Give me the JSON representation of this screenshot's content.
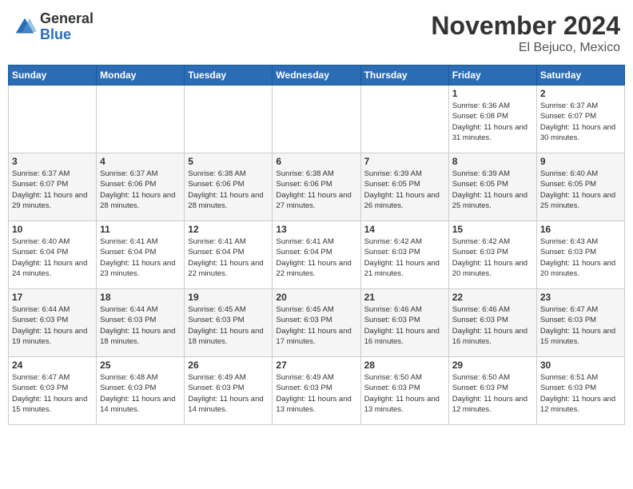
{
  "header": {
    "logo_general": "General",
    "logo_blue": "Blue",
    "month_title": "November 2024",
    "location": "El Bejuco, Mexico"
  },
  "calendar": {
    "days_of_week": [
      "Sunday",
      "Monday",
      "Tuesday",
      "Wednesday",
      "Thursday",
      "Friday",
      "Saturday"
    ],
    "weeks": [
      [
        {
          "day": "",
          "info": ""
        },
        {
          "day": "",
          "info": ""
        },
        {
          "day": "",
          "info": ""
        },
        {
          "day": "",
          "info": ""
        },
        {
          "day": "",
          "info": ""
        },
        {
          "day": "1",
          "info": "Sunrise: 6:36 AM\nSunset: 6:08 PM\nDaylight: 11 hours and 31 minutes."
        },
        {
          "day": "2",
          "info": "Sunrise: 6:37 AM\nSunset: 6:07 PM\nDaylight: 11 hours and 30 minutes."
        }
      ],
      [
        {
          "day": "3",
          "info": "Sunrise: 6:37 AM\nSunset: 6:07 PM\nDaylight: 11 hours and 29 minutes."
        },
        {
          "day": "4",
          "info": "Sunrise: 6:37 AM\nSunset: 6:06 PM\nDaylight: 11 hours and 28 minutes."
        },
        {
          "day": "5",
          "info": "Sunrise: 6:38 AM\nSunset: 6:06 PM\nDaylight: 11 hours and 28 minutes."
        },
        {
          "day": "6",
          "info": "Sunrise: 6:38 AM\nSunset: 6:06 PM\nDaylight: 11 hours and 27 minutes."
        },
        {
          "day": "7",
          "info": "Sunrise: 6:39 AM\nSunset: 6:05 PM\nDaylight: 11 hours and 26 minutes."
        },
        {
          "day": "8",
          "info": "Sunrise: 6:39 AM\nSunset: 6:05 PM\nDaylight: 11 hours and 25 minutes."
        },
        {
          "day": "9",
          "info": "Sunrise: 6:40 AM\nSunset: 6:05 PM\nDaylight: 11 hours and 25 minutes."
        }
      ],
      [
        {
          "day": "10",
          "info": "Sunrise: 6:40 AM\nSunset: 6:04 PM\nDaylight: 11 hours and 24 minutes."
        },
        {
          "day": "11",
          "info": "Sunrise: 6:41 AM\nSunset: 6:04 PM\nDaylight: 11 hours and 23 minutes."
        },
        {
          "day": "12",
          "info": "Sunrise: 6:41 AM\nSunset: 6:04 PM\nDaylight: 11 hours and 22 minutes."
        },
        {
          "day": "13",
          "info": "Sunrise: 6:41 AM\nSunset: 6:04 PM\nDaylight: 11 hours and 22 minutes."
        },
        {
          "day": "14",
          "info": "Sunrise: 6:42 AM\nSunset: 6:03 PM\nDaylight: 11 hours and 21 minutes."
        },
        {
          "day": "15",
          "info": "Sunrise: 6:42 AM\nSunset: 6:03 PM\nDaylight: 11 hours and 20 minutes."
        },
        {
          "day": "16",
          "info": "Sunrise: 6:43 AM\nSunset: 6:03 PM\nDaylight: 11 hours and 20 minutes."
        }
      ],
      [
        {
          "day": "17",
          "info": "Sunrise: 6:44 AM\nSunset: 6:03 PM\nDaylight: 11 hours and 19 minutes."
        },
        {
          "day": "18",
          "info": "Sunrise: 6:44 AM\nSunset: 6:03 PM\nDaylight: 11 hours and 18 minutes."
        },
        {
          "day": "19",
          "info": "Sunrise: 6:45 AM\nSunset: 6:03 PM\nDaylight: 11 hours and 18 minutes."
        },
        {
          "day": "20",
          "info": "Sunrise: 6:45 AM\nSunset: 6:03 PM\nDaylight: 11 hours and 17 minutes."
        },
        {
          "day": "21",
          "info": "Sunrise: 6:46 AM\nSunset: 6:03 PM\nDaylight: 11 hours and 16 minutes."
        },
        {
          "day": "22",
          "info": "Sunrise: 6:46 AM\nSunset: 6:03 PM\nDaylight: 11 hours and 16 minutes."
        },
        {
          "day": "23",
          "info": "Sunrise: 6:47 AM\nSunset: 6:03 PM\nDaylight: 11 hours and 15 minutes."
        }
      ],
      [
        {
          "day": "24",
          "info": "Sunrise: 6:47 AM\nSunset: 6:03 PM\nDaylight: 11 hours and 15 minutes."
        },
        {
          "day": "25",
          "info": "Sunrise: 6:48 AM\nSunset: 6:03 PM\nDaylight: 11 hours and 14 minutes."
        },
        {
          "day": "26",
          "info": "Sunrise: 6:49 AM\nSunset: 6:03 PM\nDaylight: 11 hours and 14 minutes."
        },
        {
          "day": "27",
          "info": "Sunrise: 6:49 AM\nSunset: 6:03 PM\nDaylight: 11 hours and 13 minutes."
        },
        {
          "day": "28",
          "info": "Sunrise: 6:50 AM\nSunset: 6:03 PM\nDaylight: 11 hours and 13 minutes."
        },
        {
          "day": "29",
          "info": "Sunrise: 6:50 AM\nSunset: 6:03 PM\nDaylight: 11 hours and 12 minutes."
        },
        {
          "day": "30",
          "info": "Sunrise: 6:51 AM\nSunset: 6:03 PM\nDaylight: 11 hours and 12 minutes."
        }
      ]
    ]
  }
}
